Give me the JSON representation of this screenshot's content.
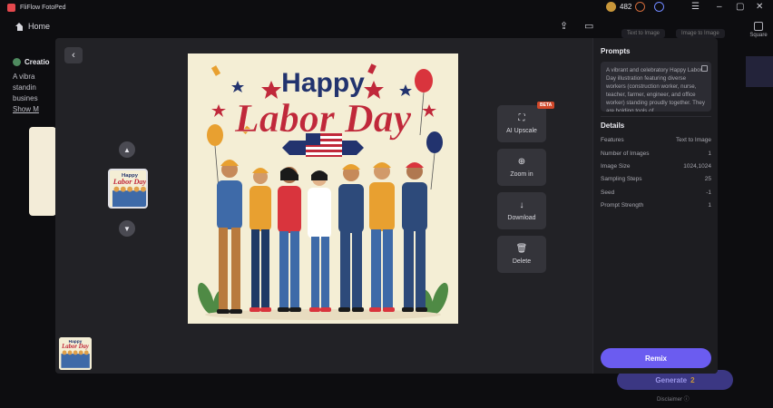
{
  "app": {
    "title": "FliFlow FotoPed"
  },
  "topbar": {
    "home_label": "Home",
    "credits": "482",
    "square_label": "Square"
  },
  "background": {
    "tab_text_to_image": "Text to Image",
    "tab_image_to_image": "Image to Image",
    "creation_title": "Creatio",
    "desc_lines": [
      "A vibra",
      "standin",
      "busines"
    ],
    "show_more": "Show M",
    "generate_label": "Generate",
    "generate_cost": "2",
    "disclaimer": "Disclaimer"
  },
  "modal": {
    "actions": [
      {
        "name": "ai-upscale",
        "icon": "⛶",
        "label": "AI Upscale"
      },
      {
        "name": "zoom-in",
        "icon": "⊕",
        "label": "Zoom in"
      },
      {
        "name": "download",
        "icon": "↓",
        "label": "Download"
      },
      {
        "name": "delete",
        "icon": "🗑",
        "label": "Delete"
      }
    ],
    "beta_badge": "BETA",
    "art_title_1": "Happy",
    "art_title_2": "Labor Day"
  },
  "panel": {
    "prompts_heading": "Prompts",
    "prompt_text": "A vibrant and celebratory Happy Labor Day illustration featuring diverse workers (construction worker, nurse, teacher, farmer, engineer, and office worker) standing proudly together. They are holding tools of",
    "details_heading": "Details",
    "details": [
      {
        "label": "Features",
        "value": "Text to Image"
      },
      {
        "label": "Number of Images",
        "value": "1"
      },
      {
        "label": "Image Size",
        "value": "1024,1024"
      },
      {
        "label": "Sampling Steps",
        "value": "25"
      },
      {
        "label": "Seed",
        "value": "-1"
      },
      {
        "label": "Prompt Strength",
        "value": "1"
      }
    ],
    "remix_label": "Remix"
  },
  "colors": {
    "accent": "#6b5cf0",
    "title_red": "#c0283a",
    "title_navy": "#22336e"
  }
}
